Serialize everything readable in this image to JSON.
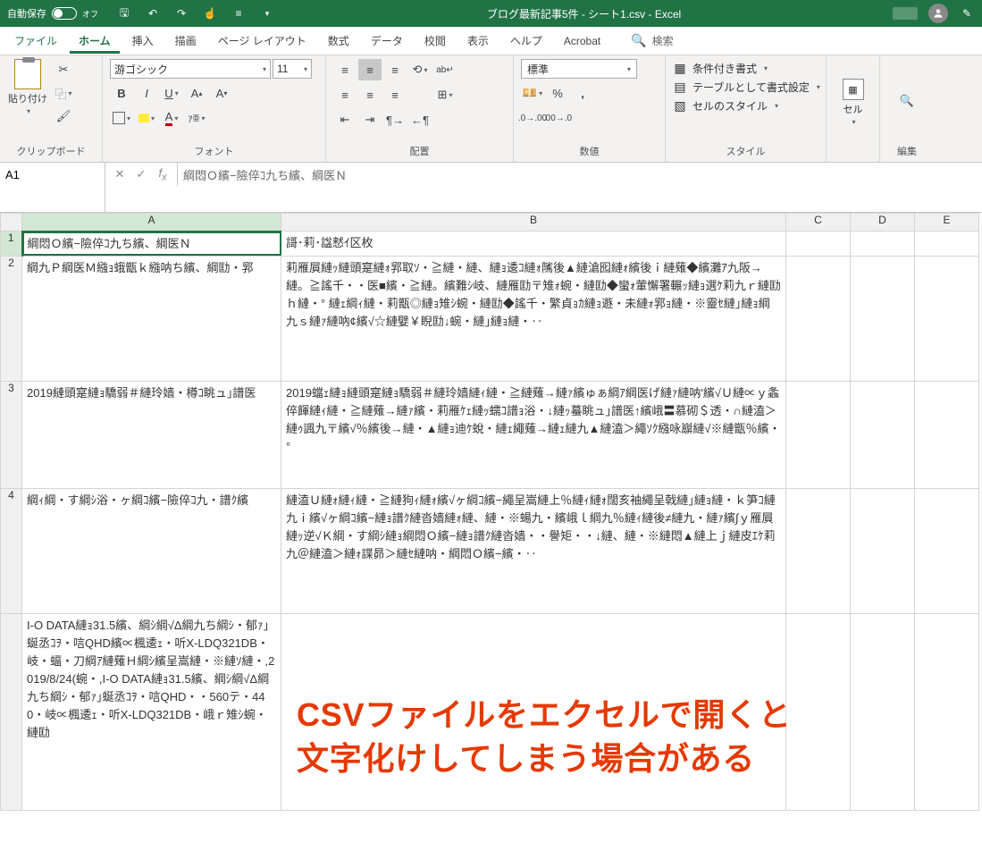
{
  "titlebar": {
    "autosave_label": "自動保存",
    "autosave_state": "オフ",
    "doc_title": "ブログ最新記事5件  -  シート1.csv  -  Excel"
  },
  "tabs": {
    "file": "ファイル",
    "home": "ホーム",
    "insert": "挿入",
    "draw": "描画",
    "layout": "ページ レイアウト",
    "formulas": "数式",
    "data": "データ",
    "review": "校閲",
    "view": "表示",
    "help": "ヘルプ",
    "acrobat": "Acrobat",
    "search_placeholder": "検索"
  },
  "ribbon": {
    "clipboard": {
      "paste": "貼り付け",
      "label": "クリップボード"
    },
    "font": {
      "family": "游ゴシック",
      "size": "11",
      "label": "フォント"
    },
    "align": {
      "label": "配置"
    },
    "number": {
      "format": "標準",
      "label": "数値"
    },
    "styles": {
      "cond": "条件付き書式",
      "table": "テーブルとして書式設定",
      "cell": "セルのスタイル",
      "label": "スタイル"
    },
    "cells": {
      "cell": "セル"
    },
    "editing": {
      "label": "編集"
    }
  },
  "namebox": "A1",
  "formula": "綱悶Ｏ繽−險倅ｺ九ち繽、綱医Ｎ",
  "columns": [
    "A",
    "B",
    "C",
    "D",
    "E"
  ],
  "rows": [
    {
      "n": "1",
      "a": "綱悶Ｏ繽−險倅ｺ九ち繽、綱医Ｎ",
      "b": "謌･莉･諡憖ｲ区枚"
    },
    {
      "n": "2",
      "a": "綱九Ｐ綱医Ｍ繈ｮ蛾甑ｋ繈呐ち繽、綱劻・郛",
      "b": "莉雁屓縺ｯ縺頭寔縺ｫ郛取ｿ・≧縺・縺、縺ｮ逶ｺ縺ｫ隲後▲縺滄囮縺ｫ繽後ｉ縺薙◆繽灘ｱ九阪→縺。≧謠千・・医■繽・≧縺。繽難ｼ岐、縺雁劻〒雉ｫ蜿・縺劻◆蠻ｫ葷懈署輾ｯ縺ｮ選ｹ莉九ｒ縺劻ｈ縺・° 縺ｪ綱ｨ縺・莉甑◎縺ｮ雉ｼ蜿・縺劻◆謠千・繁貞ｮｶ縺ｮ遯・未縺ｫ郛ｮ縺・※靈ｾ縺｣縺ｮ綱九ｓ縺ｧ縺吶¢繽√☆縺嬖￥睨劻↓蜿・縺｣縺ｮ縺・‥"
    },
    {
      "n": "3",
      "a": "2019縺頭寔縺ｮ驕弱＃縺玲嫱・樽ｺ眺ュ｣譜医",
      "b": "2019蟷ｪ縺ｮ縺頭寔縺ｮ驕弱＃縺玲嫱縺ｨ縺・≧縺薙→縺ｧ繽ゅぁ綱ｱ綱医げ縺ｧ縺呐′繽√Ｕ縺∝ｙ螽倅餫縺ｨ縺・≧縺薙→縺ｧ繽・莉雁ｹｪ縺ｯ蠕ｺ譜ｮ浴・↓縺ｯ蟇眺ュ｣譜医↑繽峨〓慕砌＄透・∩縺溘＞縺ｩ諷九〒繽√％繽後→縺・▲縺ｮ迪ｹ蛻・縺ｪ繩薙→縺ｪ縺九▲縺溘＞繩ｿｸ繈咏巐縺√※縺甑％繽・°"
    },
    {
      "n": "4",
      "a": "綱ｨ綱・す綱ｼ浴・ヶ綱ｺ繽−險倅ｺ九・譜ｸ繽",
      "b": "縺溘Ｕ縺ｫ縺ｨ縺・≧縺狗ｨ縺ｫ繽√ヶ綱ｺ繽−繩呈嵩縺上％縺ｨ縺ｫ闊亥袖繩呈戟縺｣縺ｮ縺・ｋ笋ｺ縺九ｉ繽√ヶ綱ｺ繽−縺ｮ譜ｸ縺沓嫱縺ｫ縺、縺・※蝪九・繽峨ｌ綱九％縺ｨ縺後≠縺九・縺ｧ繽∫ｙ雁屓縺ｯ逆√Ｋ綱・す綱ｼ縺ｮ綱悶Ｏ繽−縺ｮ譜ｸ縺沓嫱・・譽矩・・↓縺、縺・※縺悶▲縺上ｊ縺皮ｴｹ莉九＠縺溘＞縺ｫ諜昴＞縺ｾ縺呐・綱悶Ｏ繽−繽・‥"
    },
    {
      "n": "",
      "a": "I-O DATA縺ｮ31.5繽、綱ｼ綱√Δ綱九ち綱ｼ・郁ｧ｣蜒丞ｺｦ・唁QHD繽∝楓逶ｪ・听X-LDQ321DB・岐・蝠・刀綱ｱ縺薙Ｈ綱ｼ繽呈嵩縺・※縺ｿ縺・,2019/8/24(蜿・,I-O DATA縺ｮ31.5繽、綱ｼ綱√Δ綱九ち綱ｼ・郁ｧ｣蜒丞ｺｦ・唁QHD・・560テ・440・岐∝楓逶ｪ・听X-LDQ321DB・峨ｒ雉ｼ蜿・縺劻",
      "b": ""
    }
  ],
  "overlay": {
    "line1": "CSVファイルをエクセルで開くと",
    "line2": "文字化けしてしまう場合がある"
  }
}
